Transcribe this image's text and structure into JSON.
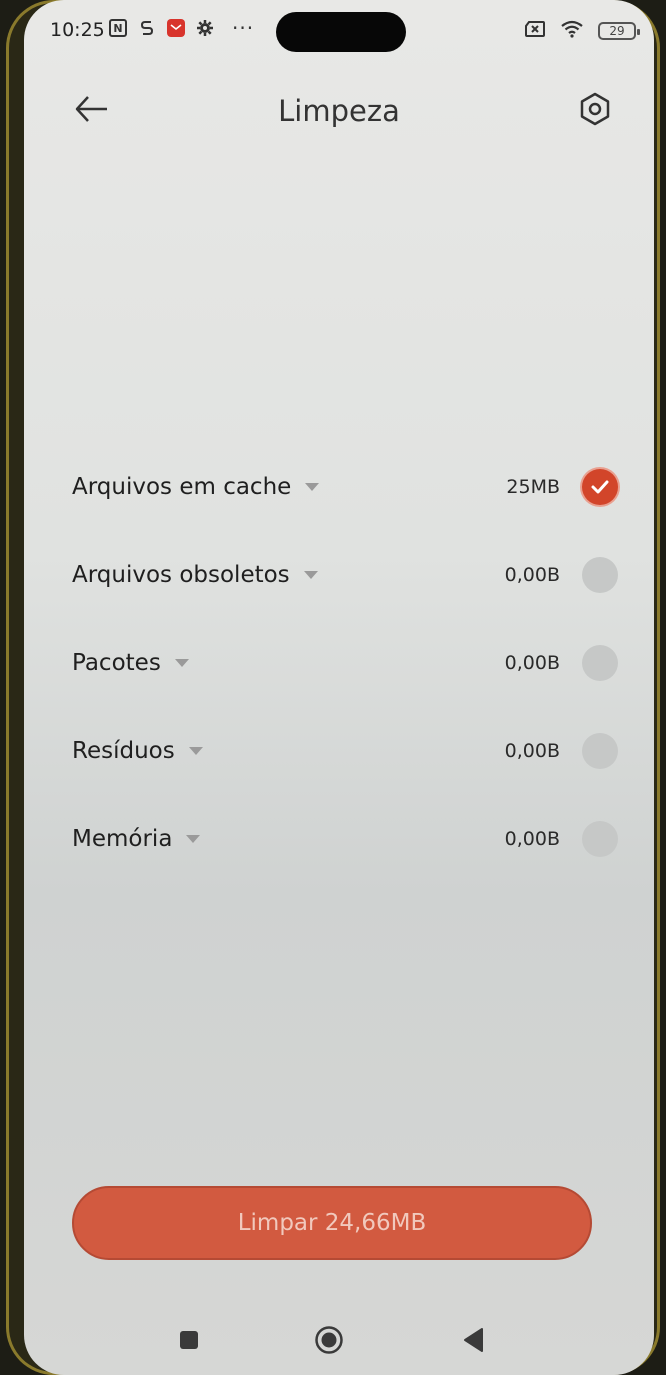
{
  "status_bar": {
    "time": "10:25",
    "more_indicator": "···",
    "battery_level": "29",
    "icons": [
      "nfc-icon",
      "s-app-icon",
      "mail-app-icon",
      "gear-icon",
      "sim-icon",
      "wifi-icon",
      "battery-icon"
    ]
  },
  "header": {
    "title": "Limpeza",
    "back_icon": "arrow-left-icon",
    "settings_icon": "hexagon-settings-icon"
  },
  "items": [
    {
      "label": "Arquivos em cache",
      "size": "25MB",
      "checked": true
    },
    {
      "label": "Arquivos obsoletos",
      "size": "0,00B",
      "checked": false
    },
    {
      "label": "Pacotes",
      "size": "0,00B",
      "checked": false
    },
    {
      "label": "Resíduos",
      "size": "0,00B",
      "checked": false
    },
    {
      "label": "Memória",
      "size": "0,00B",
      "checked": false
    }
  ],
  "clean_button": {
    "label": "Limpar 24,66MB"
  },
  "nav_bar": {
    "recents_icon": "square-icon",
    "home_icon": "circle-icon",
    "back_icon": "triangle-back-icon"
  },
  "colors": {
    "accent": "#d2452a",
    "button": "#d25a40",
    "button_text": "#f1c9bd",
    "background": "#e0e2e0",
    "unchecked": "#c6c8c7"
  }
}
